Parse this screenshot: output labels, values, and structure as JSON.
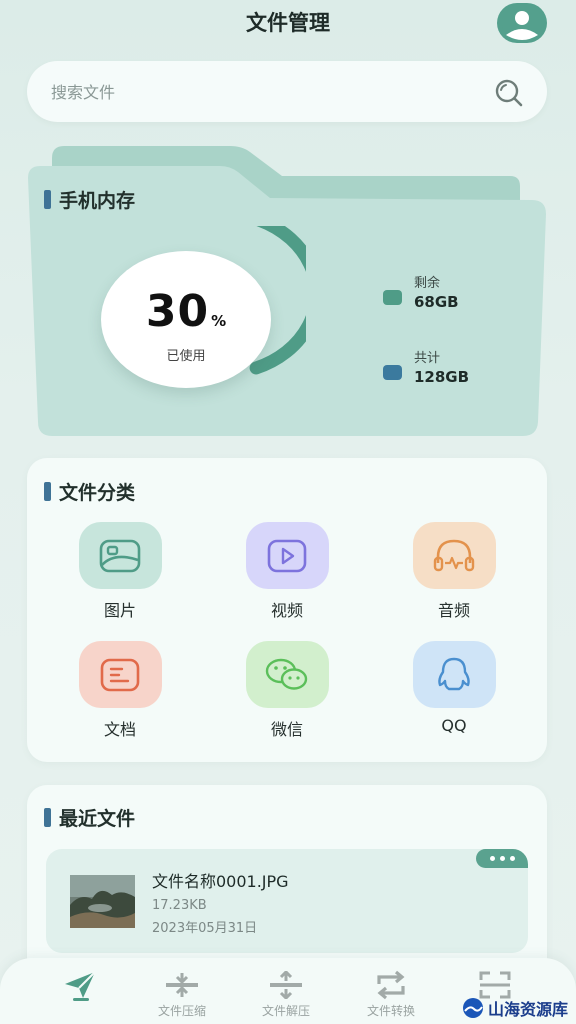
{
  "header": {
    "title": "文件管理",
    "avatar_icon": "user-avatar-icon"
  },
  "search": {
    "placeholder": "搜索文件",
    "value": ""
  },
  "storage": {
    "title": "手机内存",
    "used_percent": 30,
    "used_value": "30",
    "unit": "%",
    "used_label": "已使用",
    "legend": [
      {
        "label": "剩余",
        "value": "68GB",
        "color": "#4f9c87"
      },
      {
        "label": "共计",
        "value": "128GB",
        "color": "#3b7a9e"
      }
    ]
  },
  "categories": {
    "title": "文件分类",
    "items": [
      {
        "label": "图片",
        "icon": "image-icon",
        "bg": "#c7e5dc",
        "color": "#4f9c87"
      },
      {
        "label": "视频",
        "icon": "video-play-icon",
        "bg": "#d7d6fa",
        "color": "#7d73dd"
      },
      {
        "label": "音频",
        "icon": "headphones-icon",
        "bg": "#f6dec6",
        "color": "#e3924c"
      },
      {
        "label": "文档",
        "icon": "document-icon",
        "bg": "#f7d4ca",
        "color": "#e16a4a"
      },
      {
        "label": "微信",
        "icon": "wechat-icon",
        "bg": "#d2efcd",
        "color": "#5bbf5a"
      },
      {
        "label": "QQ",
        "icon": "qq-icon",
        "bg": "#cfe4f7",
        "color": "#4a8fcf"
      }
    ]
  },
  "recent": {
    "title": "最近文件",
    "items": [
      {
        "name": "文件名称0001.JPG",
        "size": "17.23KB",
        "date": "2023年05月31日"
      }
    ]
  },
  "bottom_nav": {
    "items": [
      {
        "label": "",
        "icon": "send-icon",
        "active": true
      },
      {
        "label": "文件压缩",
        "icon": "compress-icon"
      },
      {
        "label": "文件解压",
        "icon": "decompress-icon"
      },
      {
        "label": "文件转换",
        "icon": "convert-icon"
      },
      {
        "label": "",
        "icon": "scan-icon"
      }
    ]
  },
  "watermark": {
    "text": "山海资源库"
  },
  "colors": {
    "accent": "#54a08d",
    "background": "#dcece8",
    "card": "#f4fbf9"
  }
}
